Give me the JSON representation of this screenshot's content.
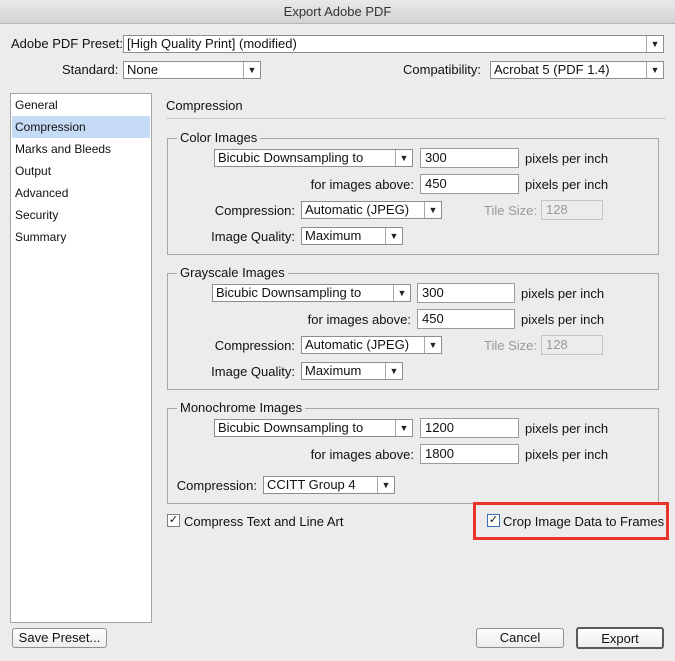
{
  "window": {
    "title": "Export Adobe PDF"
  },
  "header": {
    "preset_label": "Adobe PDF Preset:",
    "preset_value": "[High Quality Print] (modified)",
    "standard_label": "Standard:",
    "standard_value": "None",
    "compat_label": "Compatibility:",
    "compat_value": "Acrobat 5 (PDF 1.4)"
  },
  "sidebar": {
    "items": [
      {
        "label": "General"
      },
      {
        "label": "Compression"
      },
      {
        "label": "Marks and Bleeds"
      },
      {
        "label": "Output"
      },
      {
        "label": "Advanced"
      },
      {
        "label": "Security"
      },
      {
        "label": "Summary"
      }
    ],
    "selected": "Compression"
  },
  "main": {
    "section_title": "Compression",
    "color": {
      "title": "Color Images",
      "downsample": "Bicubic Downsampling to",
      "ppi": "300",
      "ppi_unit": "pixels per inch",
      "above_label": "for images above:",
      "above": "450",
      "above_unit": "pixels per inch",
      "compression_label": "Compression:",
      "compression": "Automatic (JPEG)",
      "tile_label": "Tile Size:",
      "tile": "128",
      "quality_label": "Image Quality:",
      "quality": "Maximum"
    },
    "gray": {
      "title": "Grayscale Images",
      "downsample": "Bicubic Downsampling to",
      "ppi": "300",
      "ppi_unit": "pixels per inch",
      "above_label": "for images above:",
      "above": "450",
      "above_unit": "pixels per inch",
      "compression_label": "Compression:",
      "compression": "Automatic (JPEG)",
      "tile_label": "Tile Size:",
      "tile": "128",
      "quality_label": "Image Quality:",
      "quality": "Maximum"
    },
    "mono": {
      "title": "Monochrome Images",
      "downsample": "Bicubic Downsampling to",
      "ppi": "1200",
      "ppi_unit": "pixels per inch",
      "above_label": "for images above:",
      "above": "1800",
      "above_unit": "pixels per inch",
      "compression_label": "Compression:",
      "compression": "CCITT Group 4"
    },
    "compress_text": {
      "label": "Compress Text and Line Art",
      "checked": true
    },
    "crop_image": {
      "label": "Crop Image Data to Frames",
      "checked": true
    }
  },
  "footer": {
    "save_preset": "Save Preset...",
    "cancel": "Cancel",
    "export": "Export"
  },
  "icons": {
    "check": "✓",
    "arrow": "▼"
  },
  "colors": {
    "highlight": "#e8352a",
    "selected_row": "#c6dcf6"
  }
}
